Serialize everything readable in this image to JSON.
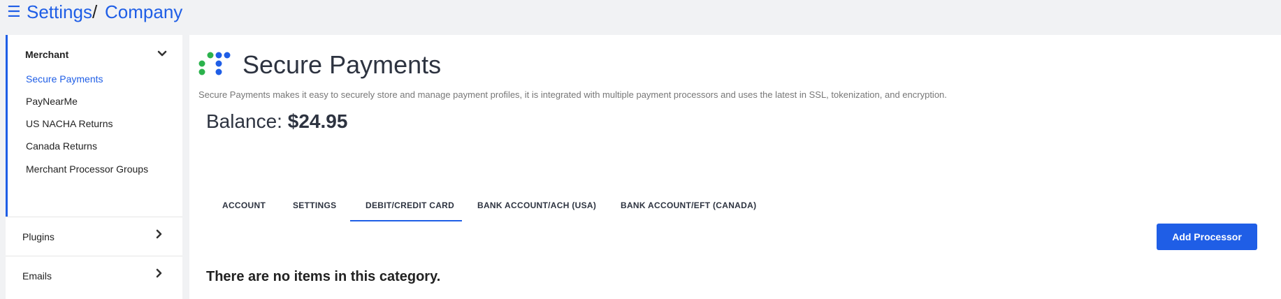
{
  "breadcrumb": {
    "menu_icon": "☰",
    "parent": "Settings",
    "separator": "/",
    "current": "Company"
  },
  "sidebar": {
    "merchant": {
      "title": "Merchant",
      "items": [
        {
          "label": "Secure Payments",
          "active": true
        },
        {
          "label": "PayNearMe"
        },
        {
          "label": "US NACHA Returns"
        },
        {
          "label": "Canada Returns"
        },
        {
          "label": "Merchant Processor Groups"
        }
      ]
    },
    "plugins": {
      "title": "Plugins"
    },
    "emails": {
      "title": "Emails"
    }
  },
  "main": {
    "title": "Secure Payments",
    "description": "Secure Payments makes it easy to securely store and manage payment profiles, it is integrated with multiple payment processors and uses the latest in SSL, tokenization, and encryption.",
    "balance_label": "Balance:",
    "balance_value": "$24.95",
    "tabs": [
      {
        "label": "ACCOUNT"
      },
      {
        "label": "SETTINGS"
      },
      {
        "label": "DEBIT/CREDIT CARD",
        "active": true
      },
      {
        "label": "BANK ACCOUNT/ACH (USA)"
      },
      {
        "label": "BANK ACCOUNT/EFT (CANADA)"
      }
    ],
    "add_processor_label": "Add Processor",
    "empty_message": "There are no items in this category."
  },
  "colors": {
    "accent": "#1f5ee6",
    "logo_green": "#2bb24c",
    "logo_blue": "#1f5ee6"
  }
}
